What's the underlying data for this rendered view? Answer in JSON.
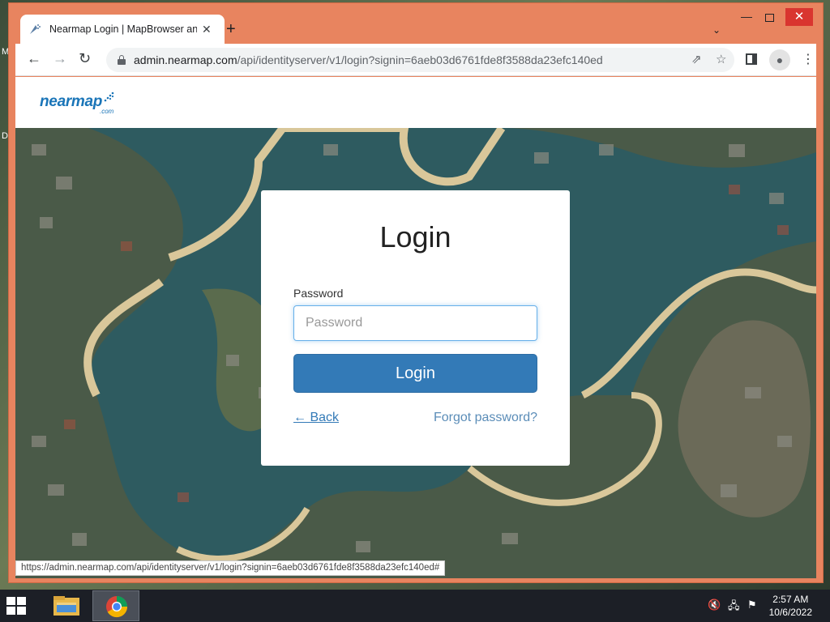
{
  "browser": {
    "tab_title": "Nearmap Login | MapBrowser and",
    "url_host": "admin.nearmap.com",
    "url_path": "/api/identityserver/v1/login?signin=6aeb03d6761fde8f3588da23efc140ed",
    "status_url": "https://admin.nearmap.com/api/identityserver/v1/login?signin=6aeb03d6761fde8f3588da23efc140ed#"
  },
  "page": {
    "logo_text": "nearmap",
    "logo_sub": ".com"
  },
  "login": {
    "title": "Login",
    "password_label": "Password",
    "password_placeholder": "Password",
    "password_value": "",
    "submit_label": "Login",
    "back_label": "← Back",
    "forgot_label": "Forgot password?"
  },
  "taskbar": {
    "time": "2:57 AM",
    "date": "10/6/2022"
  },
  "desktop": {
    "icon_letters": [
      "M",
      "D"
    ]
  },
  "colors": {
    "accent": "#337ab7",
    "window_frame": "#e8845f",
    "logo": "#1a75b8"
  }
}
